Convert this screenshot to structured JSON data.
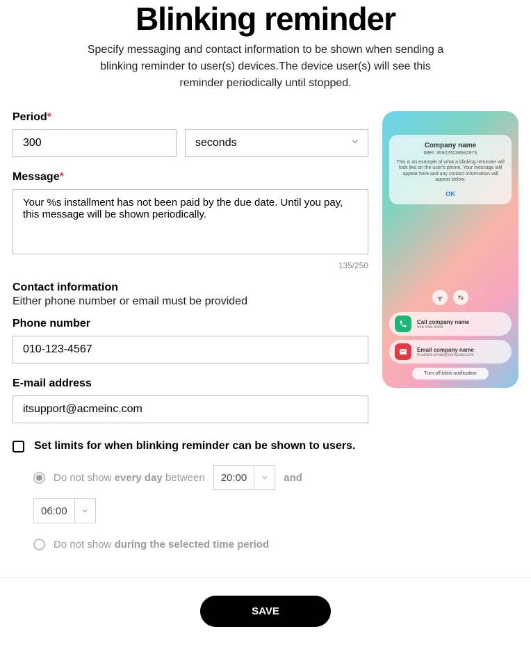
{
  "header": {
    "title": "Blinking reminder",
    "subtitle": "Specify messaging and contact information to be shown when sending a blinking reminder to user(s) devices.The device user(s) will see this reminder periodically until stopped."
  },
  "form": {
    "period_label": "Period",
    "period_value": "300",
    "unit_value": "seconds",
    "message_label": "Message",
    "message_value": "Your %s installment has not been paid by the due date. Until you pay, this message will be shown periodically.",
    "char_count": "135/250",
    "contact_header": "Contact information",
    "contact_sub": "Either phone number or email must be provided",
    "phone_label": "Phone number",
    "phone_value": "010-123-4567",
    "email_label": "E-mail address",
    "email_value": "itsupport@acmeinc.com",
    "limits_label": "Set limits for when blinking reminder can be shown  to users.",
    "radio1_pre": "Do not show",
    "radio1_bold": "every day",
    "radio1_between": "between",
    "time_start": "20:00",
    "time_and": "and",
    "time_end": "06:00",
    "radio2_pre": "Do not show",
    "radio2_bold": "during the selected time period"
  },
  "preview": {
    "company": "Company name",
    "imei": "IMEI: 359225038932976",
    "body": "This is an example of what a blinking reminder will look like on the user's phone. Your message will appear here and any contact information will appear below.",
    "ok": "OK",
    "call_title": "Call company name",
    "call_sub": "555-555-5555",
    "email_title": "Email company name",
    "email_sub": "example.email@company.com",
    "turn_off": "Turn off blink notification"
  },
  "footer": {
    "save": "SAVE"
  }
}
